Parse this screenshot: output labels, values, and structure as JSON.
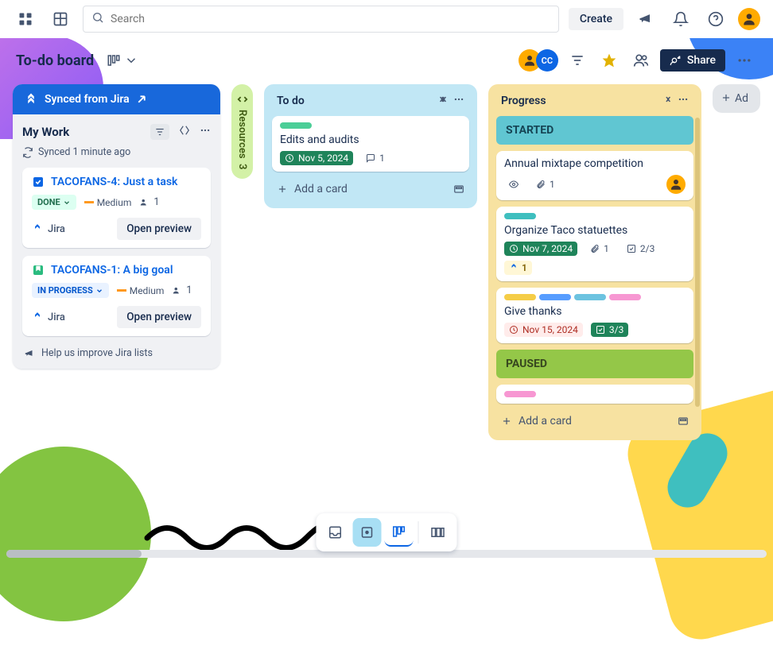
{
  "topbar": {
    "search_placeholder": "Search",
    "create_label": "Create"
  },
  "board_header": {
    "title": "To-do board",
    "share_label": "Share",
    "member_initials": "CC"
  },
  "jira_list": {
    "header": "Synced from Jira",
    "subhead": "My Work",
    "sync_text": "Synced 1 minute ago",
    "cards": [
      {
        "title": "TACOFANS-4: Just a task",
        "status": "DONE",
        "priority": "Medium",
        "assignee_count": "1",
        "source": "Jira",
        "preview_label": "Open preview"
      },
      {
        "title": "TACOFANS-1: A big goal",
        "status": "IN PROGRESS",
        "priority": "Medium",
        "assignee_count": "1",
        "source": "Jira",
        "preview_label": "Open preview"
      }
    ],
    "footer": "Help us improve Jira lists"
  },
  "resources": {
    "label": "Resources",
    "count": "3"
  },
  "lists": {
    "todo": {
      "title": "To do",
      "add_label": "Add a card",
      "cards": [
        {
          "title": "Edits and audits",
          "date": "Nov 5, 2024",
          "comments": "1"
        }
      ]
    },
    "progress": {
      "title": "Progress",
      "add_label": "Add a card",
      "sections": {
        "started": "STARTED",
        "paused": "PAUSED"
      },
      "cards": [
        {
          "title": "Annual mixtape competition",
          "attachments": "1"
        },
        {
          "title": "Organize Taco statuettes",
          "date": "Nov 7, 2024",
          "attachments": "1",
          "checklist": "2/3",
          "jira_count": "1"
        },
        {
          "title": "Give thanks",
          "date": "Nov 15, 2024",
          "checklist": "3/3"
        }
      ]
    }
  },
  "next_list": {
    "add_label": "Ad"
  }
}
